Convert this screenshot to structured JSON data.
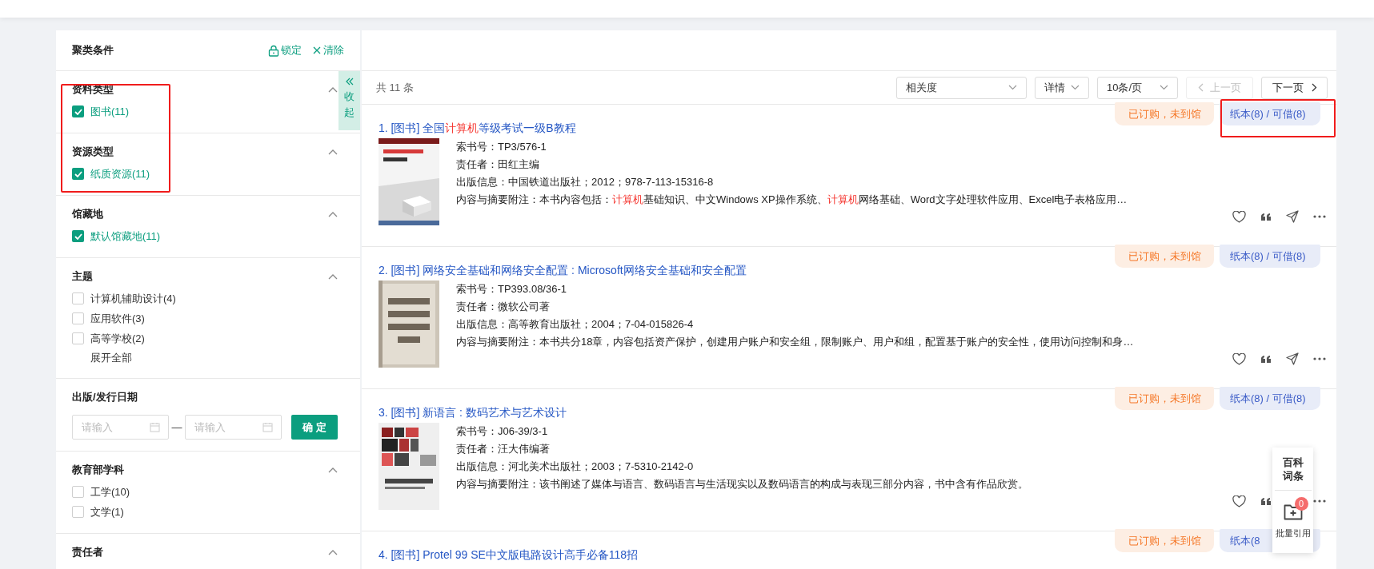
{
  "filter_panel": {
    "title": "聚类条件",
    "lock_label": "锁定",
    "clear_label": "清除",
    "collapse_label": "收起",
    "sections": [
      {
        "kind": "options",
        "title": "资料类型",
        "expanded": true,
        "options": [
          {
            "label": "图书(11)",
            "checked": true
          }
        ]
      },
      {
        "kind": "options",
        "title": "资源类型",
        "expanded": true,
        "options": [
          {
            "label": "纸质资源(11)",
            "checked": true
          }
        ]
      },
      {
        "kind": "options",
        "title": "馆藏地",
        "expanded": true,
        "options": [
          {
            "label": "默认馆藏地(11)",
            "checked": true
          }
        ]
      },
      {
        "kind": "options",
        "title": "主题",
        "expanded": true,
        "options": [
          {
            "label": "计算机辅助设计(4)",
            "checked": false
          },
          {
            "label": "应用软件(3)",
            "checked": false
          },
          {
            "label": "高等学校(2)",
            "checked": false
          }
        ],
        "more_label": "展开全部"
      },
      {
        "kind": "date",
        "title": "出版/发行日期",
        "from_placeholder": "请输入",
        "to_placeholder": "请输入",
        "separator": "—",
        "confirm_label": "确 定"
      },
      {
        "kind": "options",
        "title": "教育部学科",
        "expanded": true,
        "options": [
          {
            "label": "工学(10)",
            "checked": false
          },
          {
            "label": "文学(1)",
            "checked": false
          }
        ]
      },
      {
        "kind": "options",
        "title": "责任者",
        "expanded": true
      }
    ]
  },
  "results": {
    "total_label": "共 11 条",
    "sort": "相关度",
    "view": "详情",
    "page_size": "10条/页",
    "prev_label": "上一页",
    "prev_disabled": true,
    "next_label": "下一页",
    "items": [
      {
        "title": [
          {
            "text": "1. [图书] 全国",
            "highlight": false
          },
          {
            "text": "计算机",
            "highlight": true
          },
          {
            "text": "等级考试一级B教程",
            "highlight": false
          }
        ],
        "cover": {
          "kind": "picture"
        },
        "fields": [
          "索书号：TP3/576-1",
          "责任者：田红主编",
          "出版信息：中国铁道出版社；2012；978-7-113-15316-8"
        ],
        "abstract": [
          {
            "text": "内容与摘要附注：本书内容包括：",
            "highlight": false
          },
          {
            "text": "计算机",
            "highlight": true
          },
          {
            "text": "基础知识、中文Windows XP操作系统、",
            "highlight": false
          },
          {
            "text": "计算机",
            "highlight": true
          },
          {
            "text": "网络基础、Word文字处理软件应用、Excel电子表格应用…",
            "highlight": false
          }
        ],
        "badges": [
          {
            "kind": "order",
            "text": "已订购，未到馆"
          },
          {
            "kind": "holdings",
            "text": "纸本(8) / 可借(8)"
          }
        ]
      },
      {
        "title": [
          {
            "text": "2. [图书] 网络安全基础和网络安全配置 : Microsoft网络安全基础和安全配置",
            "highlight": false
          }
        ],
        "cover": {
          "kind": "picture"
        },
        "fields": [
          "索书号：TP393.08/36-1",
          "责任者：微软公司著",
          "出版信息：高等教育出版社；2004；7-04-015826-4"
        ],
        "abstract": [
          {
            "text": "内容与摘要附注：本书共分18章，内容包括资产保护，创建用户账户和安全组，限制账户、用户和组，配置基于账户的安全性，使用访问控制和身…",
            "highlight": false
          }
        ],
        "badges": [
          {
            "kind": "order",
            "text": "已订购，未到馆"
          },
          {
            "kind": "holdings",
            "text": "纸本(8) / 可借(8)"
          }
        ]
      },
      {
        "title": [
          {
            "text": "3. [图书] 新语言 : 数码艺术与艺术设计",
            "highlight": false
          }
        ],
        "cover": {
          "kind": "picture"
        },
        "fields": [
          "索书号：J06-39/3-1",
          "责任者：汪大伟编著",
          "出版信息：河北美术出版社；2003；7-5310-2142-0"
        ],
        "abstract": [
          {
            "text": "内容与摘要附注：该书阐述了媒体与语言、数码语言与生活现实以及数码语言的构成与表现三部分内容，书中含有作品欣赏。",
            "highlight": false
          }
        ],
        "badges": [
          {
            "kind": "order",
            "text": "已订购，未到馆"
          },
          {
            "kind": "holdings",
            "text": "纸本(8) / 可借(8)"
          }
        ]
      },
      {
        "title": [
          {
            "text": "4. [图书] Protel 99 SE中文版电路设计高手必备118招",
            "highlight": false
          }
        ],
        "badges": [
          {
            "kind": "order",
            "text": "已订购，未到馆"
          },
          {
            "kind": "holdings",
            "text": "纸本(8"
          }
        ]
      }
    ]
  },
  "side_widget": {
    "encyclopedia_label": "百科词条",
    "cite_count": "0",
    "cite_label": "批量引用"
  }
}
